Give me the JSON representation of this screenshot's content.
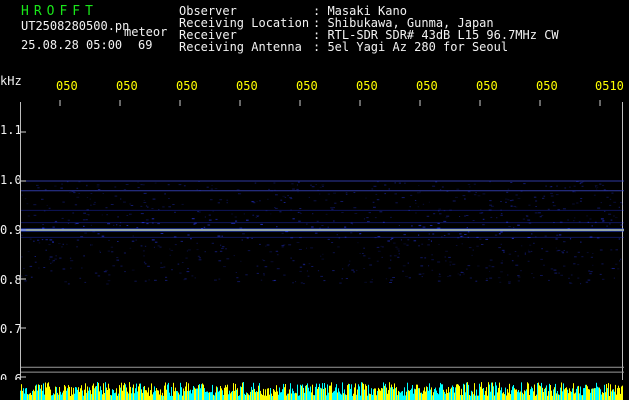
{
  "header": {
    "program": "HROFFT",
    "file_name": "UT2508280500.pn",
    "event_type": "meteor",
    "date_time": "25.08.28 05:00",
    "count": "69"
  },
  "info": {
    "labels": [
      "Observer",
      "Receiving Location",
      "Receiver",
      "Receiving Antenna"
    ],
    "values": [
      ": Masaki Kano",
      ": Shibukawa, Gunma, Japan",
      ": RTL-SDR SDR# 43dB L15 96.7MHz CW",
      ": 5el Yagi Az 280 for Seoul"
    ]
  },
  "axis": {
    "unit": "kHz",
    "y_labels": [
      "1.1",
      "1.0",
      "0.9",
      "0.8",
      "0.7",
      "0.6"
    ],
    "y_values": [
      1.1,
      1.0,
      0.9,
      0.8,
      0.7,
      0.6
    ],
    "x_labels": [
      "050",
      "050",
      "050",
      "050",
      "050",
      "050",
      "050",
      "050",
      "050",
      "0510"
    ]
  },
  "chart_data": {
    "type": "heatmap",
    "ylabel": "kHz",
    "ylim": [
      0.6,
      1.12
    ],
    "x": [
      "050",
      "050",
      "050",
      "050",
      "050",
      "050",
      "050",
      "050",
      "050",
      "0510"
    ],
    "carrier_khz": 0.9,
    "band_khz": [
      0.79,
      1.0
    ],
    "reference_lines_khz": [
      1.0,
      0.98,
      0.62,
      0.61
    ],
    "colors": {
      "background": "#000000",
      "signal": "#2a3cff",
      "carrier": "#ffff66",
      "noise_bar": "#ffff00",
      "noise_bar_alt": "#00ffff"
    }
  }
}
